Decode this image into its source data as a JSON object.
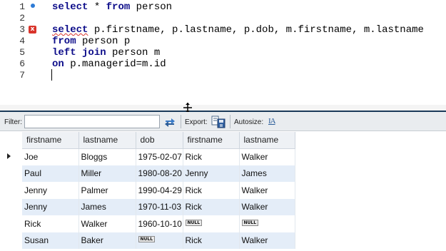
{
  "editor": {
    "line_numbers": [
      "1",
      "2",
      "3",
      "4",
      "5",
      "6",
      "7"
    ],
    "lines": {
      "l1": {
        "kw1": "select",
        "t1": " * ",
        "kw2": "from",
        "t2": " person"
      },
      "l3": {
        "kw1": "select",
        "t1": " p.firstname, p.lastname, p.dob, m.firstname, m.lastname"
      },
      "l4": {
        "kw1": "from",
        "t1": " person p"
      },
      "l5": {
        "kw1": "left",
        "t1": " ",
        "kw2": "join",
        "t2": " person m"
      },
      "l6": {
        "kw1": "on",
        "t1": " p.managerid=m.id"
      }
    },
    "error_marker": "x"
  },
  "toolbar": {
    "filter_label": "Filter:",
    "filter_value": "",
    "export_label": "Export:",
    "autosize_label": "Autosize:",
    "autosize_glyph": "IA"
  },
  "grid": {
    "columns": [
      "firstname",
      "lastname",
      "dob",
      "firstname",
      "lastname"
    ],
    "null_text": "NULL",
    "rows": [
      [
        "Joe",
        "Bloggs",
        "1975-02-07",
        "Rick",
        "Walker"
      ],
      [
        "Paul",
        "Miller",
        "1980-08-20",
        "Jenny",
        "James"
      ],
      [
        "Jenny",
        "Palmer",
        "1990-04-29",
        "Rick",
        "Walker"
      ],
      [
        "Jenny",
        "James",
        "1970-11-03",
        "Rick",
        "Walker"
      ],
      [
        "Rick",
        "Walker",
        "1960-10-10",
        "NULL",
        "NULL"
      ],
      [
        "Susan",
        "Baker",
        "NULL",
        "Rick",
        "Walker"
      ]
    ]
  },
  "colors": {
    "keyword": "#0d0d8a",
    "alt_row": "#e4edf8",
    "error": "#d9342b",
    "bookmark": "#2e7bd6"
  }
}
